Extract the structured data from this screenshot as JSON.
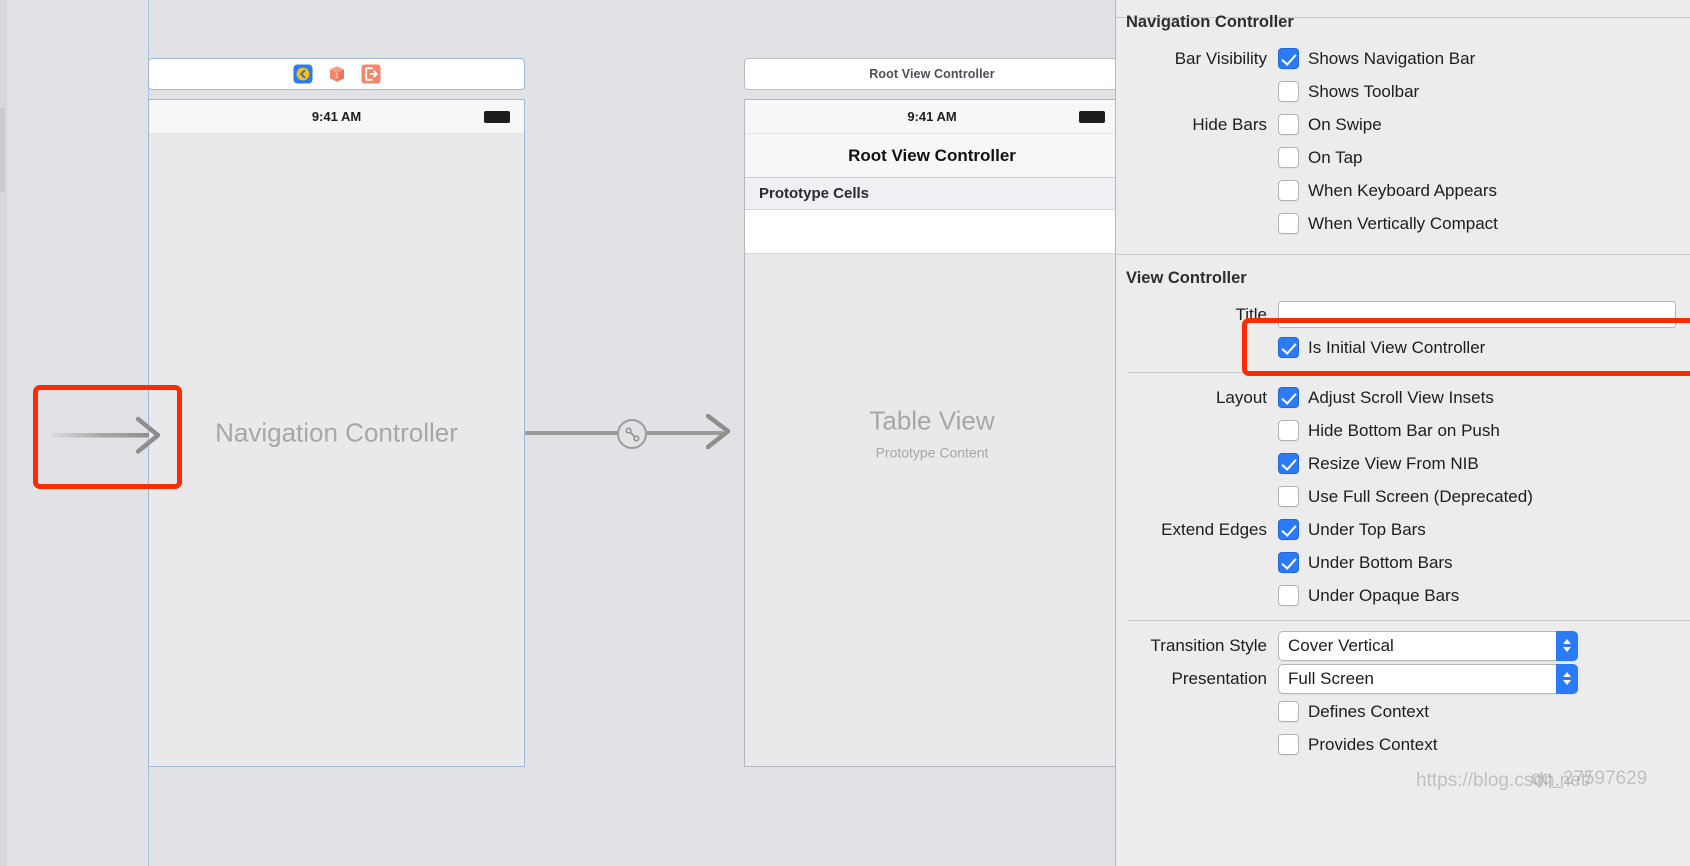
{
  "canvas": {
    "scenes": [
      {
        "dock_title": "",
        "dock_icons": [
          "view-controller-icon",
          "first-responder-icon",
          "exit-icon"
        ],
        "status_time": "9:41 AM",
        "placeholder_title": "Navigation Controller",
        "placeholder_subtitle": ""
      },
      {
        "dock_title": "Root View Controller",
        "status_time": "9:41 AM",
        "nav_title": "Root View Controller",
        "prototype_header": "Prototype Cells",
        "placeholder_title": "Table View",
        "placeholder_subtitle": "Prototype Content"
      }
    ],
    "entry_arrow_name": "initial-view-controller-entry-arrow",
    "segue_badge_name": "relationship-segue-badge",
    "highlight_color": "#fb2d00"
  },
  "inspector": {
    "accent_color": "#2a7bf5",
    "sections": [
      {
        "title": "Navigation Controller",
        "rows": [
          {
            "label": "Bar Visibility",
            "type": "checkbox",
            "text": "Shows Navigation Bar",
            "checked": true,
            "name": "shows-navigation-bar"
          },
          {
            "label": "",
            "type": "checkbox",
            "text": "Shows Toolbar",
            "checked": false,
            "name": "shows-toolbar"
          },
          {
            "label": "Hide Bars",
            "type": "checkbox",
            "text": "On Swipe",
            "checked": false,
            "name": "hide-bars-on-swipe"
          },
          {
            "label": "",
            "type": "checkbox",
            "text": "On Tap",
            "checked": false,
            "name": "hide-bars-on-tap"
          },
          {
            "label": "",
            "type": "checkbox",
            "text": "When Keyboard Appears",
            "checked": false,
            "name": "hide-bars-when-keyboard-appears"
          },
          {
            "label": "",
            "type": "checkbox",
            "text": "When Vertically Compact",
            "checked": false,
            "name": "hide-bars-when-vertically-compact"
          }
        ]
      },
      {
        "title": "View Controller",
        "rows": [
          {
            "label": "Title",
            "type": "textfield",
            "value": "",
            "placeholder": "",
            "name": "title-field"
          },
          {
            "label": "",
            "type": "checkbox",
            "text": "Is Initial View Controller",
            "checked": true,
            "name": "is-initial-view-controller",
            "highlighted": true
          },
          {
            "label": "",
            "type": "separator"
          },
          {
            "label": "Layout",
            "type": "checkbox",
            "text": "Adjust Scroll View Insets",
            "checked": true,
            "name": "adjust-scroll-view-insets"
          },
          {
            "label": "",
            "type": "checkbox",
            "text": "Hide Bottom Bar on Push",
            "checked": false,
            "name": "hide-bottom-bar-on-push"
          },
          {
            "label": "",
            "type": "checkbox",
            "text": "Resize View From NIB",
            "checked": true,
            "name": "resize-view-from-nib"
          },
          {
            "label": "",
            "type": "checkbox",
            "text": "Use Full Screen (Deprecated)",
            "checked": false,
            "name": "use-full-screen-deprecated"
          },
          {
            "label": "Extend Edges",
            "type": "checkbox",
            "text": "Under Top Bars",
            "checked": true,
            "name": "extend-edges-under-top-bars"
          },
          {
            "label": "",
            "type": "checkbox",
            "text": "Under Bottom Bars",
            "checked": true,
            "name": "extend-edges-under-bottom-bars"
          },
          {
            "label": "",
            "type": "checkbox",
            "text": "Under Opaque Bars",
            "checked": false,
            "name": "extend-edges-under-opaque-bars"
          },
          {
            "label": "",
            "type": "separator"
          },
          {
            "label": "Transition Style",
            "type": "popup",
            "value": "Cover Vertical",
            "name": "transition-style-popup"
          },
          {
            "label": "Presentation",
            "type": "popup",
            "value": "Full Screen",
            "name": "presentation-popup"
          },
          {
            "label": "",
            "type": "checkbox",
            "text": "Defines Context",
            "checked": false,
            "name": "defines-context"
          },
          {
            "label": "",
            "type": "checkbox",
            "text": "Provides Context",
            "checked": false,
            "name": "provides-context"
          }
        ]
      }
    ]
  },
  "watermark": {
    "left_text": "https://blog.csdn.net/",
    "right_text": "qq_27597629"
  }
}
